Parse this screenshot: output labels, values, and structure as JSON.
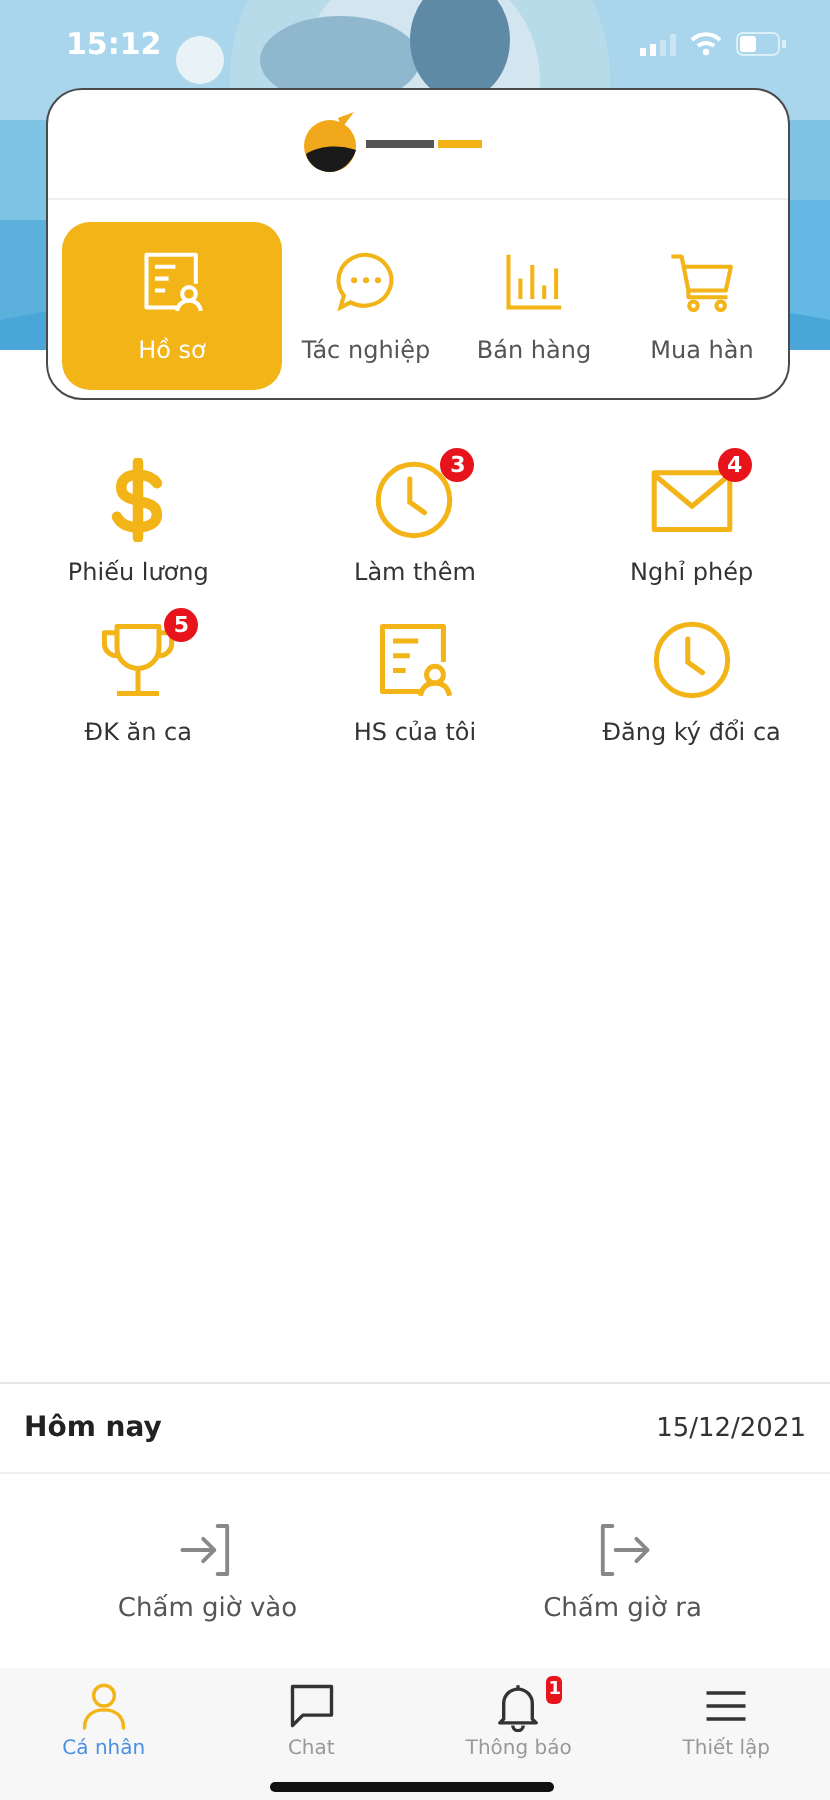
{
  "status_bar": {
    "time": "15:12"
  },
  "modules": [
    {
      "label": "Hồ sơ",
      "kind": "profile",
      "selected": true
    },
    {
      "label": "Tác nghiệp",
      "kind": "chat",
      "selected": false
    },
    {
      "label": "Bán hàng",
      "kind": "chart",
      "selected": false
    },
    {
      "label": "Mua hàn",
      "kind": "cart",
      "selected": false
    }
  ],
  "features": [
    {
      "label": "Phiếu lương",
      "kind": "dollar"
    },
    {
      "label": "Làm thêm",
      "kind": "clock",
      "badge": "3"
    },
    {
      "label": "Nghỉ phép",
      "kind": "mail",
      "badge": "4"
    },
    {
      "label": "ĐK ăn ca",
      "kind": "trophy",
      "badge": "5"
    },
    {
      "label": "HS của tôi",
      "kind": "profile"
    },
    {
      "label": "Đăng ký đổi ca",
      "kind": "clock"
    }
  ],
  "today": {
    "title": "Hôm nay",
    "date": "15/12/2021"
  },
  "attendance": [
    {
      "label": "Chấm giờ vào",
      "kind": "in"
    },
    {
      "label": "Chấm giờ ra",
      "kind": "out"
    }
  ],
  "bottom_nav": [
    {
      "label": "Cá nhân",
      "kind": "person",
      "selected": true
    },
    {
      "label": "Chat",
      "kind": "message",
      "selected": false
    },
    {
      "label": "Thông báo",
      "kind": "bell",
      "selected": false,
      "badge": "1"
    },
    {
      "label": "Thiết lập",
      "kind": "menu",
      "selected": false
    }
  ]
}
